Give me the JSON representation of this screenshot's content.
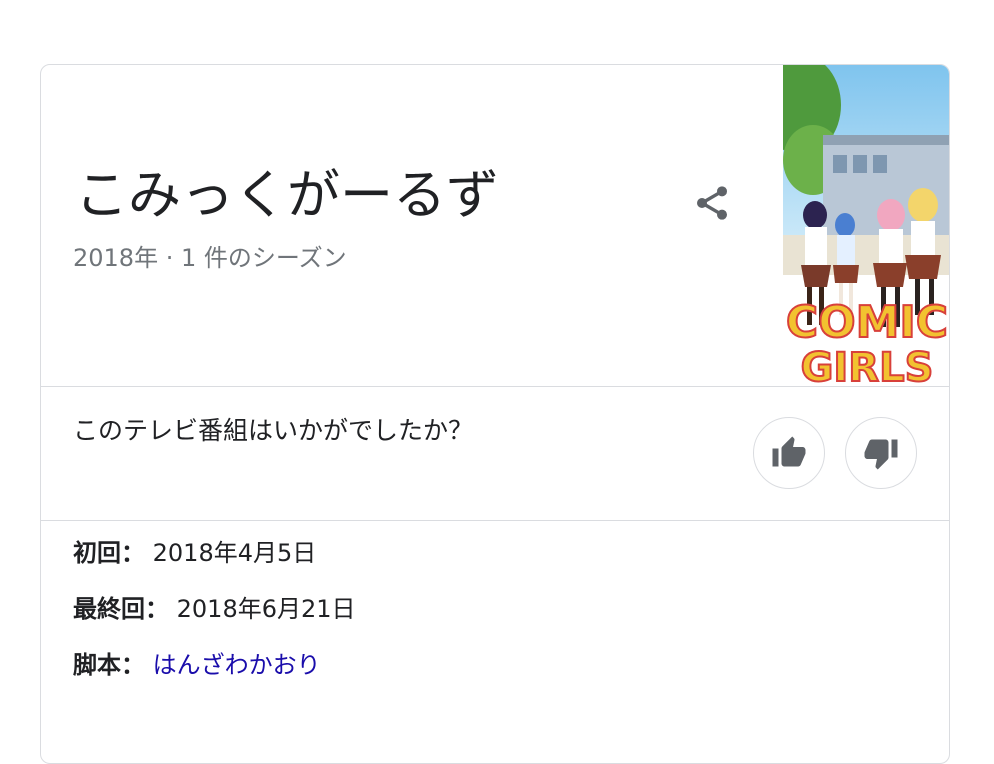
{
  "show": {
    "title": "こみっくがーるず",
    "subtitle": "2018年 · 1 件のシーズン"
  },
  "poster": {
    "logo_line1": "COMIC",
    "logo_line2": "GIRLS"
  },
  "rating": {
    "question": "このテレビ番組はいかがでしたか？"
  },
  "facts": [
    {
      "label": "初回：",
      "value": "2018年4月5日"
    },
    {
      "label": "最終回：",
      "value": "2018年6月21日"
    },
    {
      "label": "脚本：",
      "value": "はんざわかおり"
    }
  ],
  "colors": {
    "text": "#202124",
    "muted": "#70757a",
    "link": "#1a0dab",
    "border": "#dadce0",
    "icon": "#5f6368"
  }
}
